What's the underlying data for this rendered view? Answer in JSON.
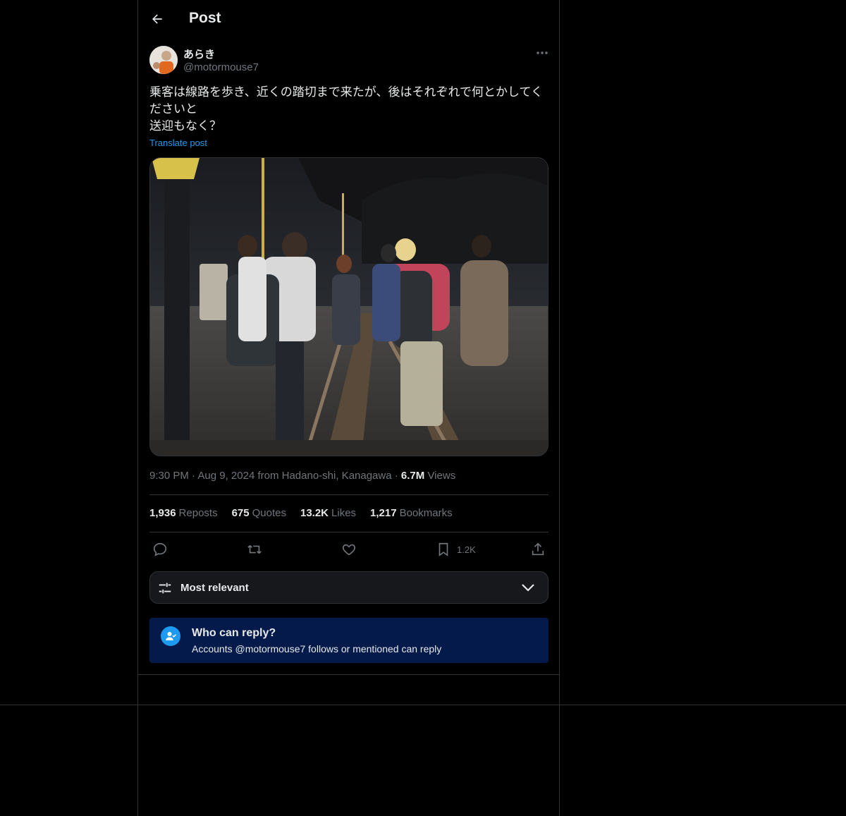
{
  "header": {
    "title": "Post",
    "back_icon": "arrow-left-icon"
  },
  "author": {
    "name": "あらき",
    "handle": "@motormouse7"
  },
  "post": {
    "text": "乗客は線路を歩き、近くの踏切まで来たが、後はそれぞれで何とかしてください​と\n送迎もなく？",
    "translate_label": "Translate post"
  },
  "meta": {
    "time": "9:30 PM",
    "date": "Aug 9, 2024",
    "location": "from Hadano-shi, Kanagawa",
    "views_count": "6.7M",
    "views_label": "Views"
  },
  "stats": [
    {
      "count": "1,936",
      "label": "Reposts"
    },
    {
      "count": "675",
      "label": "Quotes"
    },
    {
      "count": "13.2K",
      "label": "Likes"
    },
    {
      "count": "1,217",
      "label": "Bookmarks"
    }
  ],
  "actions": {
    "reply_icon": "reply-icon",
    "repost_icon": "repost-icon",
    "like_icon": "heart-icon",
    "bookmark_icon": "bookmark-icon",
    "bookmark_count": "1.2K",
    "share_icon": "share-icon"
  },
  "sort": {
    "label": "Most relevant"
  },
  "reply_restriction": {
    "title": "Who can reply?",
    "subtitle": "Accounts @motormouse7 follows or mentioned can reply"
  },
  "colors": {
    "accent": "#1d9bf0",
    "background": "#000000",
    "muted": "#71767b",
    "notice_bg": "#031a4a"
  }
}
